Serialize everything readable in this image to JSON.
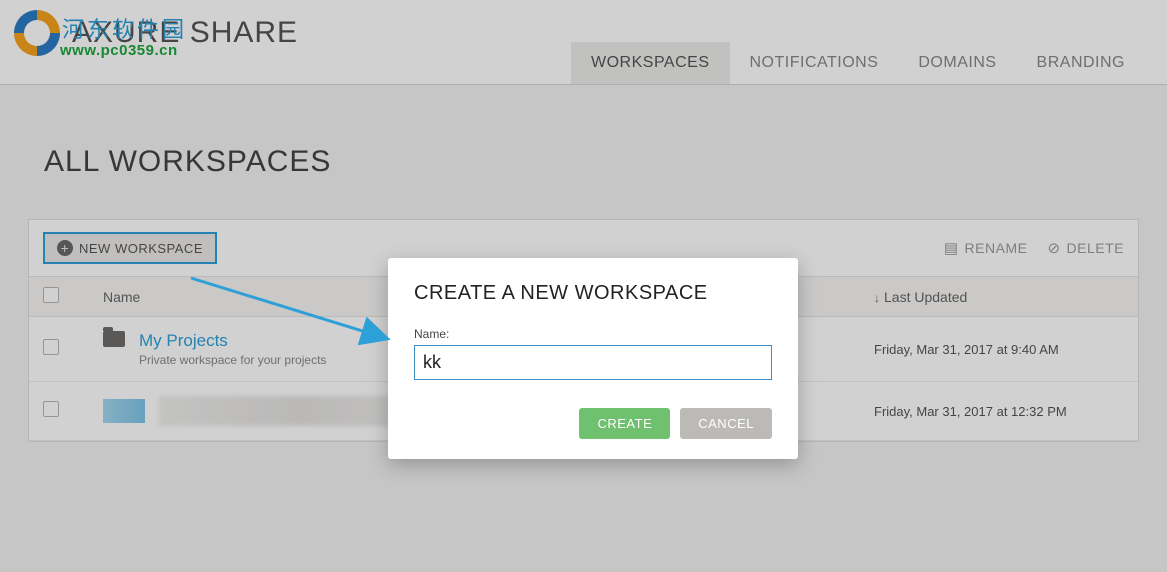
{
  "brand": {
    "title": "AXURE SHARE",
    "overlay": "河东软件园",
    "sub": "www.pc0359.cn"
  },
  "nav": {
    "workspaces": "WORKSPACES",
    "notifications": "NOTIFICATIONS",
    "domains": "DOMAINS",
    "branding": "BRANDING"
  },
  "page": {
    "title": "ALL WORKSPACES"
  },
  "toolbar": {
    "new_workspace": "NEW WORKSPACE",
    "rename": "RENAME",
    "delete": "DELETE"
  },
  "table": {
    "col_name": "Name",
    "col_updated": "Last Updated"
  },
  "rows": [
    {
      "title": "My Projects",
      "sub": "Private workspace for your projects",
      "updated": "Friday, Mar 31, 2017 at 9:40 AM"
    },
    {
      "title": "",
      "sub": "",
      "updated": "Friday, Mar 31, 2017 at 12:32 PM"
    }
  ],
  "modal": {
    "title": "CREATE A NEW WORKSPACE",
    "name_label": "Name:",
    "name_value": "kk",
    "create": "CREATE",
    "cancel": "CANCEL"
  },
  "colors": {
    "accent": "#2da0d8",
    "create": "#6fc16f",
    "cancel": "#bcbab7"
  }
}
